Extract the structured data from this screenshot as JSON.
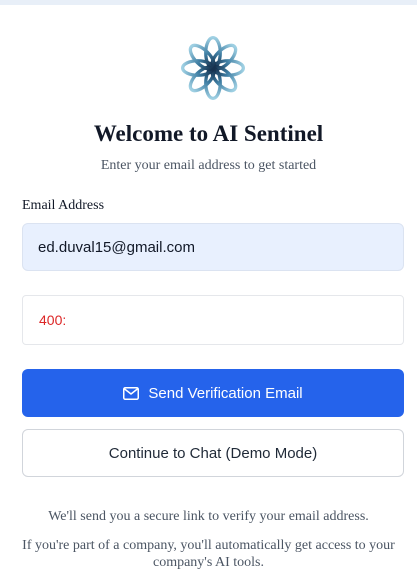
{
  "header": {
    "logo_icon": "flower-logo-icon",
    "title": "Welcome to AI Sentinel",
    "subtitle": "Enter your email address to get started"
  },
  "form": {
    "email_label": "Email Address",
    "email_value": "ed.duval15@gmail.com",
    "error_message": "400:",
    "send_button_icon": "mail-icon",
    "send_button_label": "Send Verification Email",
    "demo_button_label": "Continue to Chat (Demo Mode)"
  },
  "footer": {
    "info_line": "We'll send you a secure link to verify your email address.",
    "company_note": "If you're part of a company, you'll automatically get access to your company's AI tools."
  },
  "colors": {
    "primary": "#2563eb",
    "error": "#dc2626",
    "input_background": "#e8f0fe",
    "logo_light": "#8ec4d9",
    "logo_dark": "#1e3a5f"
  }
}
